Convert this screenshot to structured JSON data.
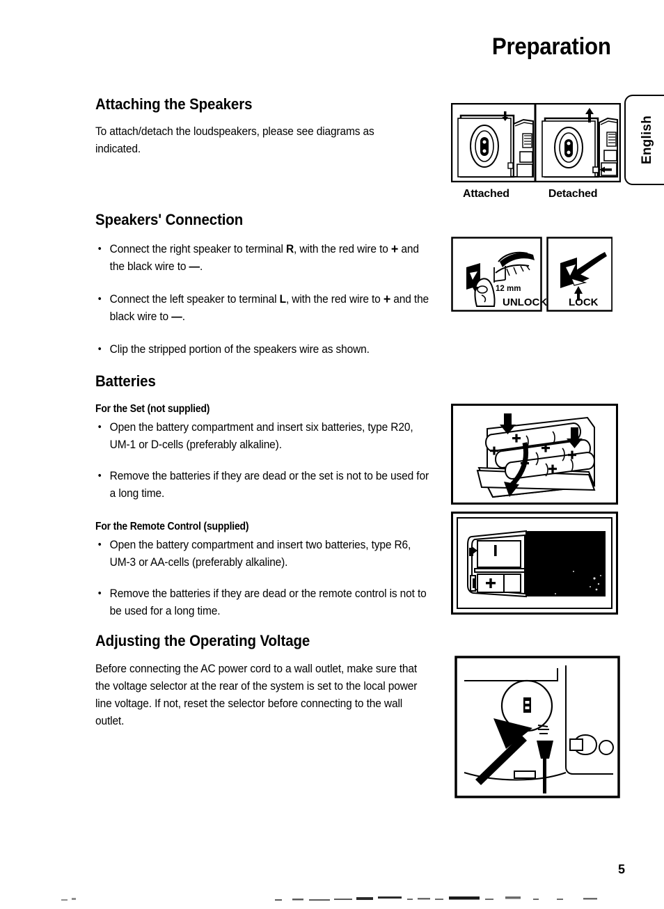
{
  "page": {
    "title": "Preparation",
    "number": "5",
    "side_tab": "English"
  },
  "sections": [
    {
      "id": "attaching-the-speakers",
      "heading": "Attaching the Speakers",
      "paragraph": "To attach/detach the loudspeakers, please see diagrams as indicated."
    },
    {
      "id": "speakers-connection",
      "heading": "Speakers' Connection",
      "bullets": [
        {
          "pre": "Connect the right speaker to terminal ",
          "term": "R",
          "mid": ", with the red wire to ",
          "plus": "+",
          "post": " and the black wire to ",
          "minus": "—",
          "end": "."
        },
        {
          "pre": "Connect the left speaker to terminal ",
          "term": "L",
          "mid": ", with the red wire to ",
          "plus": "+",
          "post": " and the black wire to ",
          "minus": "—",
          "end": "."
        }
      ],
      "bullet_plain": "Clip the stripped portion of the speakers wire as shown."
    },
    {
      "id": "batteries",
      "heading": "Batteries",
      "sub_set": "For the Set  (not supplied)",
      "set_bullets": [
        "Open the battery compartment and insert six batteries, type R20, UM-1 or D-cells (preferably alkaline).",
        "Remove the batteries if they are dead or the set is not to be used for a long time."
      ],
      "sub_remote": "For the Remote Control  (supplied)",
      "remote_bullets": [
        "Open the battery compartment and insert two batteries, type R6, UM-3 or AA-cells (preferably alkaline).",
        "Remove the batteries if they are dead or the remote control is not to be used for a long time."
      ]
    },
    {
      "id": "adjusting-the-operating-voltage",
      "heading": "Adjusting the Operating Voltage",
      "paragraph": "Before connecting the AC power cord to a wall outlet, make sure that the voltage selector at the rear of the system is set to the local power line voltage. If not, reset the selector before connecting to the wall outlet."
    }
  ],
  "figures": {
    "speakers": {
      "caption_left": "Attached",
      "caption_right": "Detached"
    },
    "lock": {
      "measure": "12 mm",
      "label_left": "UNLOCK",
      "label_right": "LOCK"
    },
    "set_batteries": {
      "polarity": "+"
    },
    "remote_batteries": {
      "polarity_minus": "—",
      "polarity_plus": "+"
    }
  }
}
